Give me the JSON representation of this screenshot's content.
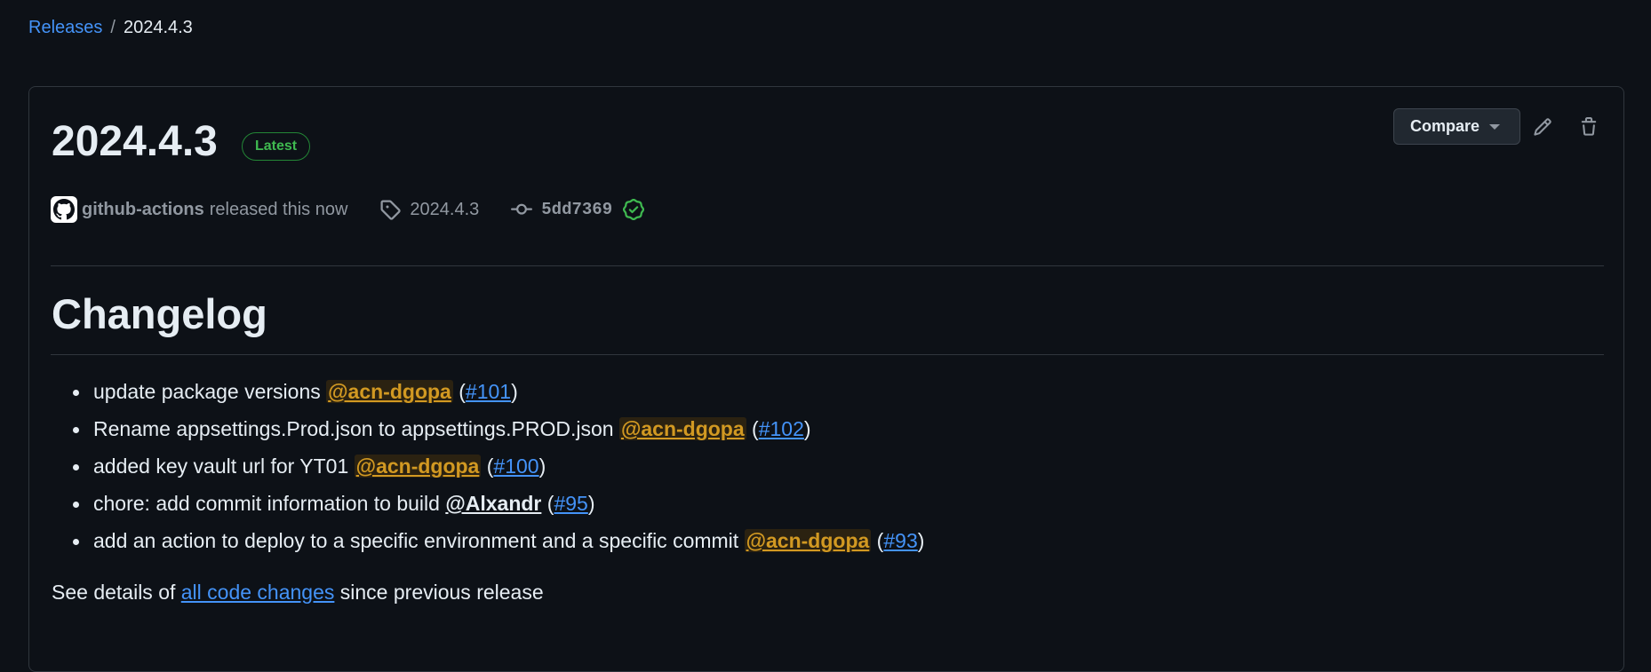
{
  "breadcrumb": {
    "parent": "Releases",
    "separator": "/",
    "current": "2024.4.3"
  },
  "release": {
    "title": "2024.4.3",
    "badge": "Latest",
    "compare_label": "Compare",
    "author": "github-actions",
    "released_text": "released this now",
    "tag": "2024.4.3",
    "commit": "5dd7369"
  },
  "changelog": {
    "heading": "Changelog",
    "items": [
      {
        "text": "update package versions",
        "mention": "@acn-dgopa",
        "pr": "#101"
      },
      {
        "text": "Rename appsettings.Prod.json to appsettings.PROD.json",
        "mention": "@acn-dgopa",
        "pr": "#102"
      },
      {
        "text": "added key vault url for YT01",
        "mention": "@acn-dgopa",
        "pr": "#100"
      },
      {
        "text": "chore: add commit information to build",
        "mention": "@Alxandr",
        "pr": "#95"
      },
      {
        "text": "add an action to deploy to a specific environment and a specific commit",
        "mention": "@acn-dgopa",
        "pr": "#93"
      }
    ]
  },
  "footer": {
    "prefix": "See details of",
    "link": "all code changes",
    "suffix": "since previous release"
  },
  "icons": {
    "edit": "pencil-icon",
    "delete": "trash-icon",
    "tag": "tag-icon",
    "commit": "git-commit-icon",
    "verified": "verified-check-icon",
    "avatar": "github-mark-icon"
  },
  "colors": {
    "accent_link": "#4493f8",
    "latest_green": "#3fb950",
    "mention_orange": "#d29922",
    "background": "#0d1117"
  }
}
